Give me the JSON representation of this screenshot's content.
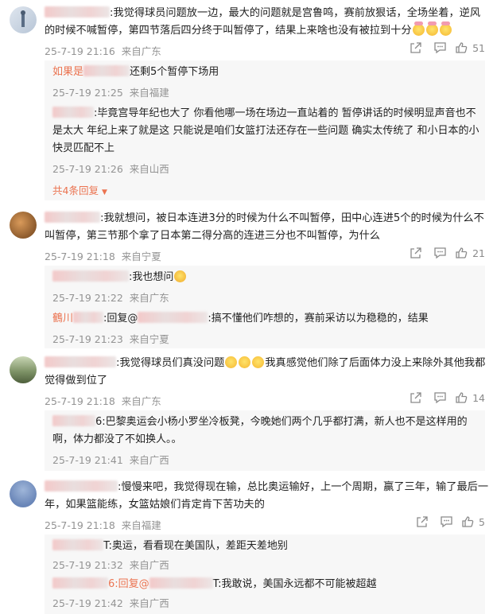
{
  "comments": [
    {
      "text": ":我觉得球员问题放一边，最大的问题就是宫鲁鸣，赛前放狠话，全场坐着，逆风的时候不喊暂停，第四节落后四分终于叫暂停了，结果上来啥也没有被拉到十分",
      "date": "25-7-19 21:16",
      "location": "来自广东",
      "likes": "51",
      "replies": [
        {
          "text": "还剩5个暂停下场用",
          "prefix": "如果是",
          "date": "25-7-19 21:25",
          "location": "来自福建"
        },
        {
          "text": ":毕竟宫导年纪也大了  你看他哪一场在场边一直站着的  暂停讲话的时候明显声音也不是太大  年纪上来了就是这  只能说是咱们女篮打法还存在一些问题  确实太传统了 和小日本的小快灵匹配不上",
          "date": "25-7-19 21:26",
          "location": "来自山西"
        }
      ],
      "more_label": "共4条回复"
    },
    {
      "text": ":我就想问，被日本连进3分的时候为什么不叫暂停，田中心连进5个的时候为什么不叫暂停，第三节那个拿了日本第二得分高的连进三分也不叫暂停，为什么",
      "date": "25-7-19 21:18",
      "location": "来自宁夏",
      "likes": "21",
      "replies": [
        {
          "text": ":我也想问",
          "date": "25-7-19 21:22",
          "location": "来自广东"
        },
        {
          "text": ":搞不懂他们咋想的，赛前采访以为稳稳的，结果",
          "prefix": "鶴川",
          "reply_label": ":回复@",
          "date": "25-7-19 21:23",
          "location": "来自宁夏"
        }
      ]
    },
    {
      "text": ":我觉得球员们真没问题",
      "text2": "我真感觉他们除了后面体力没上来除外其他我都觉得做到位了",
      "date": "25-7-19 21:18",
      "location": "来自广东",
      "likes": "14",
      "replies": [
        {
          "text": "6:巴黎奥运会小杨小罗坐冷板凳，今晚她们两个几乎都打满，新人也不是这样用的啊，体力都没了不如换人。。",
          "date": "25-7-19 21:41",
          "location": "来自广西"
        }
      ]
    },
    {
      "text": ":慢慢来吧，我觉得现在输，总比奥运输好，上一个周期，赢了三年，输了最后一年，如果篮能练，女篮姑娘们肯定肯下苦功夫的",
      "date": "25-7-19 21:18",
      "location": "来自福建",
      "likes": "5",
      "replies": [
        {
          "text": "T:奥运，看看现在美国队，差距天差地别",
          "date": "25-7-19 21:32",
          "location": "来自广西"
        },
        {
          "text": "T:我敢说，美国永远都不可能被超越",
          "prefix": "6:回复@",
          "date": "25-7-19 21:42",
          "location": "来自广西"
        }
      ]
    }
  ]
}
